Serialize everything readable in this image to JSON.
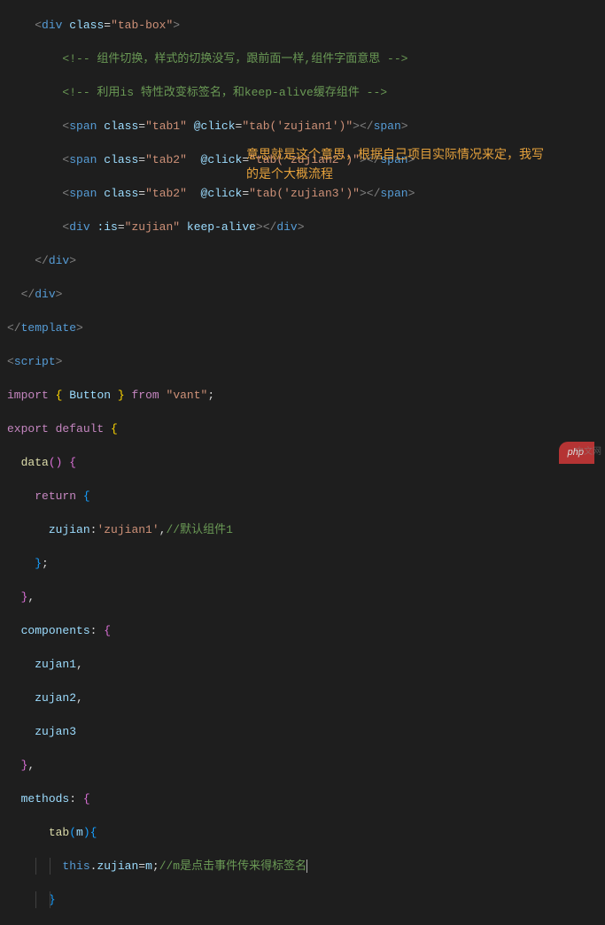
{
  "annotation": {
    "line1": "意思就是这个意思，根据自己项目实际情况来定，我写",
    "line2": "的是个大概流程"
  },
  "code": {
    "l1": {
      "div": "div",
      "class_attr": "class",
      "class_val": "\"tab-box\""
    },
    "l2": {
      "comment": "<!-- 组件切换，样式的切换没写，跟前面一样,组件字面意思 -->"
    },
    "l3": {
      "comment": "<!-- 利用is 特性改变标签名，和keep-alive缓存组件 -->"
    },
    "l4": {
      "span": "span",
      "class_attr": "class",
      "class_val": "\"tab1\"",
      "click_attr": "@click",
      "click_val": "\"tab('zujian1')\"",
      "close": "span"
    },
    "l5": {
      "span": "span",
      "class_attr": "class",
      "class_val": "\"tab2\"",
      "click_attr": "@click",
      "click_val": "\"tab('zujian2')\"",
      "close": "span"
    },
    "l6": {
      "span": "span",
      "class_attr": "class",
      "class_val": "\"tab2\"",
      "click_attr": "@click",
      "click_val": "\"tab('zujian3')\"",
      "close": "span"
    },
    "l7": {
      "div": "div",
      "is_attr": ":is",
      "is_val": "\"zujian\"",
      "keep": "keep-alive",
      "close": "div"
    },
    "l8": {
      "div_close": "div"
    },
    "l9": {
      "div_close": "div"
    },
    "l10": {
      "template_close": "template"
    },
    "l11": {
      "script_open": "script"
    },
    "l12": {
      "import": "import",
      "button": "Button",
      "from": "from",
      "vant": "\"vant\""
    },
    "l13": {
      "export": "export",
      "default": "default"
    },
    "l14": {
      "data": "data"
    },
    "l15": {
      "return": "return"
    },
    "l16": {
      "zujian": "zujian",
      "val": "'zujian1'",
      "comment": "//默认组件1"
    },
    "l18": {
      "components": "components"
    },
    "l19": {
      "c1": "zujan1"
    },
    "l20": {
      "c2": "zujan2"
    },
    "l21": {
      "c3": "zujan3"
    },
    "l23": {
      "methods": "methods"
    },
    "l24": {
      "tab": "tab",
      "m": "m"
    },
    "l25": {
      "this": "this",
      "zujian": "zujian",
      "m": "m",
      "comment": "//m是点击事件传来得标签名"
    }
  },
  "watermark": "php"
}
